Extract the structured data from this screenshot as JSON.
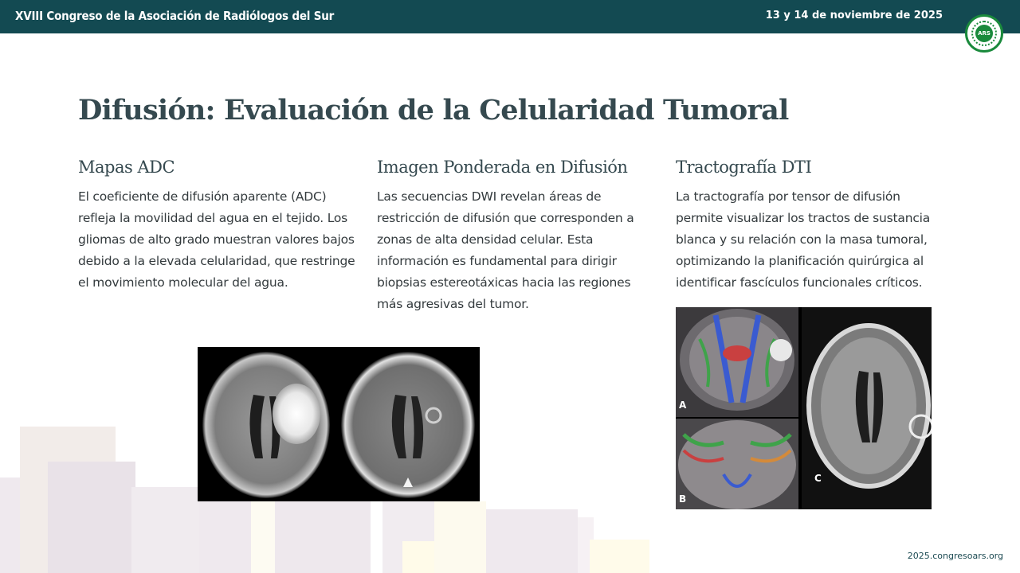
{
  "header": {
    "event_title": "XVIII Congreso de la Asociación de Radiólogos del Sur",
    "event_date": "13 y 14 de noviembre de 2025"
  },
  "logo": {
    "text": "ARS",
    "icon": "association-seal-icon"
  },
  "slide": {
    "title": "Difusión: Evaluación de la Celularidad Tumoral",
    "columns": [
      {
        "heading": "Mapas ADC",
        "body": "El coeficiente de difusión aparente (ADC) refleja la movilidad del agua en el tejido. Los gliomas de alto grado muestran valores bajos debido a la elevada celularidad, que restringe el movimiento molecular del agua."
      },
      {
        "heading": "Imagen Ponderada en Difusión",
        "body": "Las secuencias DWI revelan áreas de restricción de difusión que corresponden a zonas de alta densidad celular. Esta información es fundamental para dirigir biopsias estereotáxicas hacia las regiones más agresivas del tumor."
      },
      {
        "heading": "Tractografía DTI",
        "body": "La tractografía por tensor de difusión permite visualizar los tractos de sustancia blanca y su relación con la masa tumoral, optimizando la planificación quirúrgica al identificar fascículos funcionales críticos."
      }
    ],
    "figure_dti_labels": [
      "A",
      "B",
      "C"
    ]
  },
  "footer": {
    "url": "2025.congresoars.org"
  },
  "colors": {
    "header_bg": "#134a52",
    "title_text": "#35494f",
    "body_text": "#333a3d",
    "logo_green": "#1a8a3c"
  }
}
